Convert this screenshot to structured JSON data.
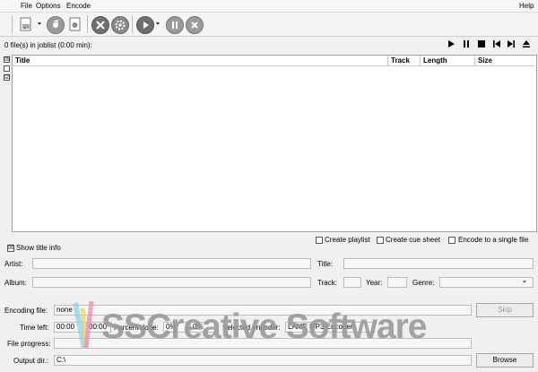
{
  "menu": {
    "file": "File",
    "options": "Options",
    "encode": "Encode",
    "help": "Help"
  },
  "toolbar": {
    "icons": [
      "add-files-icon",
      "cd-icon",
      "tag-edit-icon",
      "settings-icon",
      "configure-icon",
      "play-icon",
      "pause-icon",
      "stop-icon"
    ]
  },
  "joblist": {
    "summary": "0 file(s) in joblist (0:00 min):",
    "columns": [
      "Title",
      "Track",
      "Length",
      "Size"
    ],
    "rows": []
  },
  "side_checks": [
    "☒",
    "☐",
    "☑"
  ],
  "options": {
    "create_playlist": "Create playlist",
    "create_cue": "Create cue sheet",
    "single_file": "Encode to a single file",
    "show_title_info": "Show title info",
    "show_title_info_checked": true
  },
  "tags": {
    "artist_label": "Artist:",
    "title_label": "Title:",
    "album_label": "Album:",
    "track_label": "Track:",
    "year_label": "Year:",
    "genre_label": "Genre:"
  },
  "status": {
    "encoding_file_label": "Encoding file:",
    "encoding_file_value": "none",
    "skip_label": "Skip",
    "time_left_label": "Time left:",
    "time_left_value": "00:00",
    "elapsed_value": "00:00",
    "percent_label": "Percent done:",
    "percent_value": "0%",
    "percent_value2": "0%",
    "selected_encoder_label": "Selected encoder:",
    "selected_encoder_value": "LAME MP3 Encoder",
    "file_progress_label": "File progress:",
    "output_dir_label": "Output dir.:",
    "output_dir_value": "C:\\",
    "browse_label": "Browse"
  },
  "watermark": "SSCreative Software"
}
